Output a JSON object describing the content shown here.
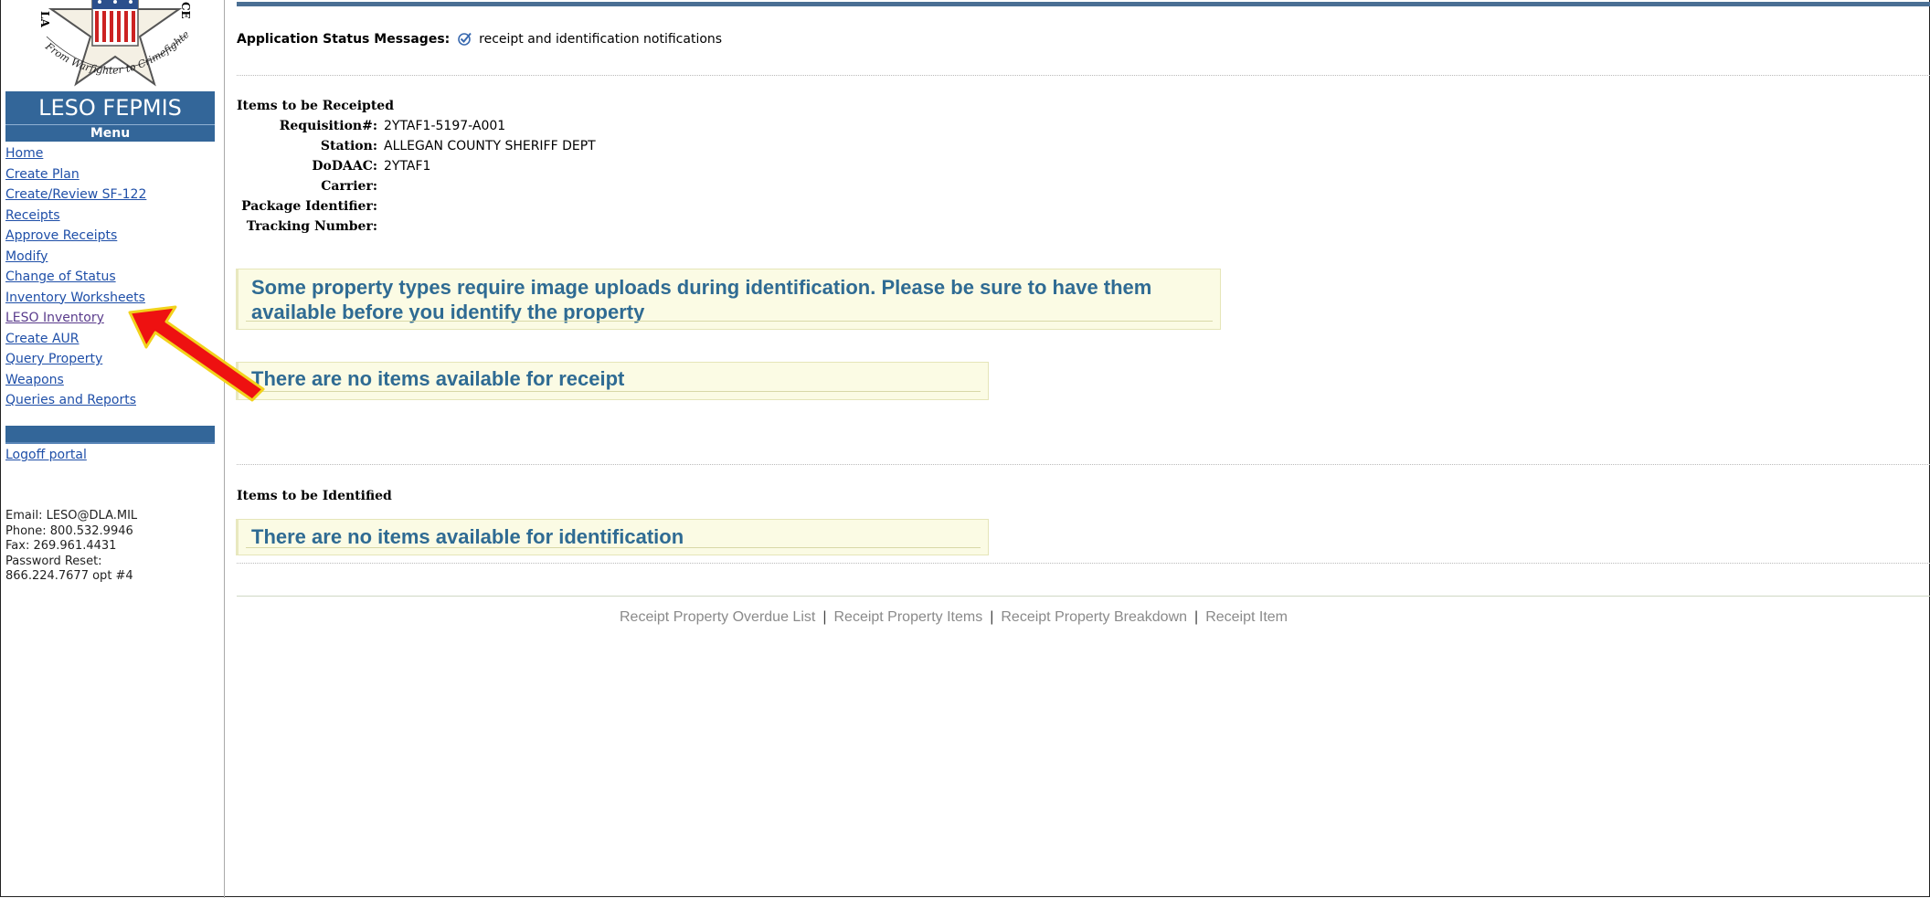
{
  "sidebar": {
    "logo_text_top_left": "LA",
    "logo_text_top_right": "CE",
    "logo_motto": "From Warfighter to Crimefighter",
    "brand": "LESO FEPMIS",
    "menu_title": "Menu",
    "items": [
      {
        "label": "Home"
      },
      {
        "label": "Create Plan"
      },
      {
        "label": "Create/Review SF-122"
      },
      {
        "label": "Receipts"
      },
      {
        "label": "Approve Receipts"
      },
      {
        "label": "Modify"
      },
      {
        "label": "Change of Status"
      },
      {
        "label": "Inventory Worksheets"
      },
      {
        "label": "LESO Inventory"
      },
      {
        "label": "Create AUR"
      },
      {
        "label": "Query Property"
      },
      {
        "label": "Weapons"
      },
      {
        "label": "Queries and Reports"
      }
    ],
    "logoff": "Logoff portal",
    "contact": {
      "email": "Email: LESO@DLA.MIL",
      "phone": "Phone: 800.532.9946",
      "fax": "Fax: 269.961.4431",
      "password_reset": "Password Reset:",
      "password_reset_number": "866.224.7677 opt #4"
    }
  },
  "status": {
    "label": "Application Status Messages:",
    "message": "receipt and identification notifications"
  },
  "receipted": {
    "title": "Items to be Receipted",
    "fields": [
      {
        "label": "Requisition#:",
        "value": "2YTAF1-5197-A001"
      },
      {
        "label": "Station:",
        "value": "ALLEGAN COUNTY SHERIFF DEPT"
      },
      {
        "label": "DoDAAC:",
        "value": "2YTAF1"
      },
      {
        "label": "Carrier:",
        "value": ""
      },
      {
        "label": "Package Identifier:",
        "value": ""
      },
      {
        "label": "Tracking Number:",
        "value": ""
      }
    ],
    "image_notice_line1": "Some property types require image uploads during identification. Please be sure to have them",
    "image_notice_line2": "available before you identify the property",
    "empty_notice": "There are no items available for receipt"
  },
  "identified": {
    "title": "Items to be Identified",
    "empty_notice": "There are no items available for identification"
  },
  "footer": {
    "links": [
      "Receipt Property Overdue List",
      "Receipt Property Items",
      "Receipt Property Breakdown",
      "Receipt Item"
    ],
    "separator": "|"
  },
  "colors": {
    "brand_blue": "#336699",
    "link_blue": "#1f4fa8",
    "notice_text": "#2f6b93",
    "notice_bg": "#fbfbe4",
    "arrow_red": "#ee1111",
    "arrow_outline": "#f2d21b"
  },
  "icons": {
    "status_check": "check-circle-icon",
    "annotation": "red-arrow-icon"
  }
}
